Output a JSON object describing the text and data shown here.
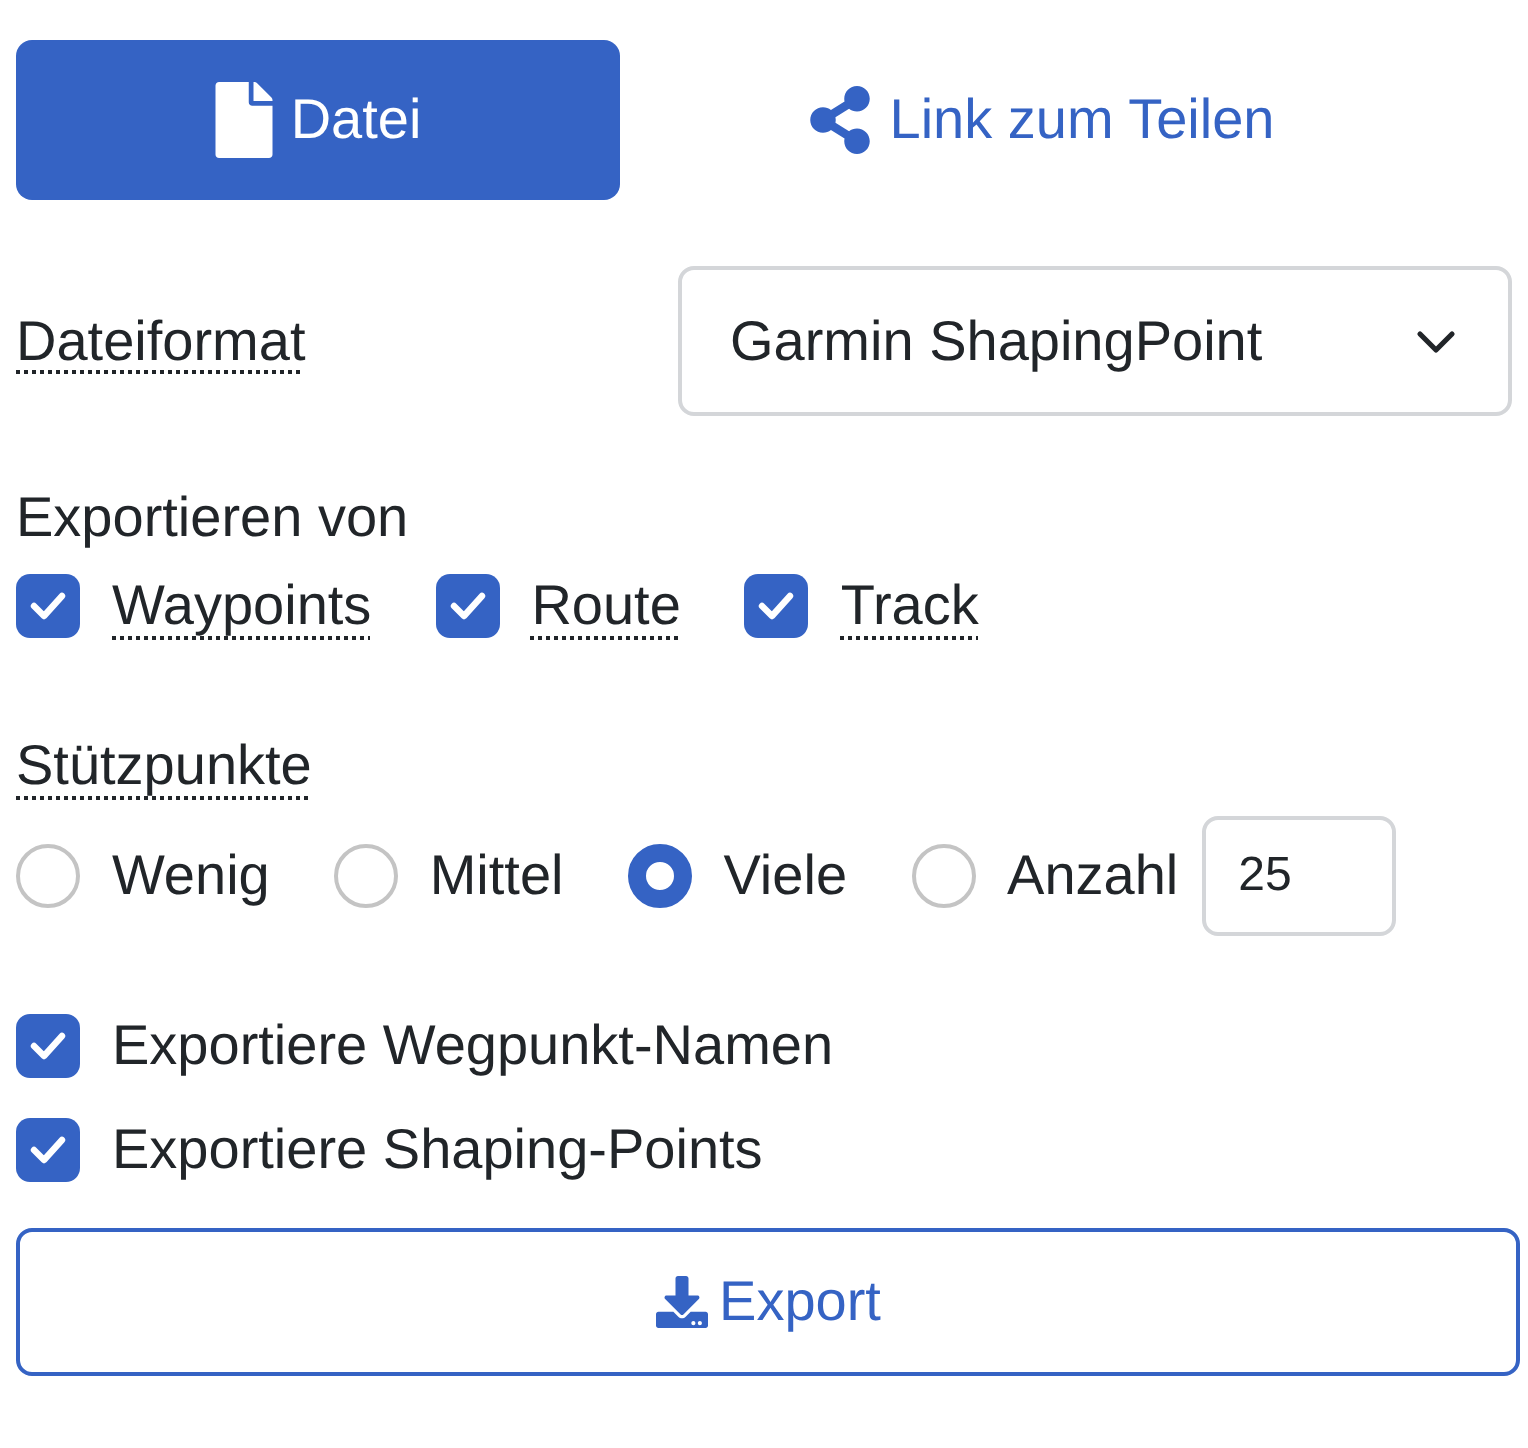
{
  "tabs": [
    {
      "label": "Datei",
      "kind": "file",
      "selected": true
    },
    {
      "label": "Link zum Teilen",
      "kind": "share",
      "selected": false
    }
  ],
  "format": {
    "label": "Dateiformat",
    "value": "Garmin ShapingPoint"
  },
  "export_from": {
    "label": "Exportieren von",
    "options": [
      {
        "label": "Waypoints",
        "checked": true
      },
      {
        "label": "Route",
        "checked": true
      },
      {
        "label": "Track",
        "checked": true
      }
    ]
  },
  "points": {
    "label": "Stützpunkte",
    "options": [
      {
        "label": "Wenig",
        "selected": false
      },
      {
        "label": "Mittel",
        "selected": false
      },
      {
        "label": "Viele",
        "selected": true
      },
      {
        "label": "Anzahl",
        "selected": false
      }
    ],
    "count": "25"
  },
  "options": [
    {
      "label": "Exportiere Wegpunkt-Namen",
      "checked": true
    },
    {
      "label": "Exportiere Shaping-Points",
      "checked": true
    }
  ],
  "export_button": "Export"
}
